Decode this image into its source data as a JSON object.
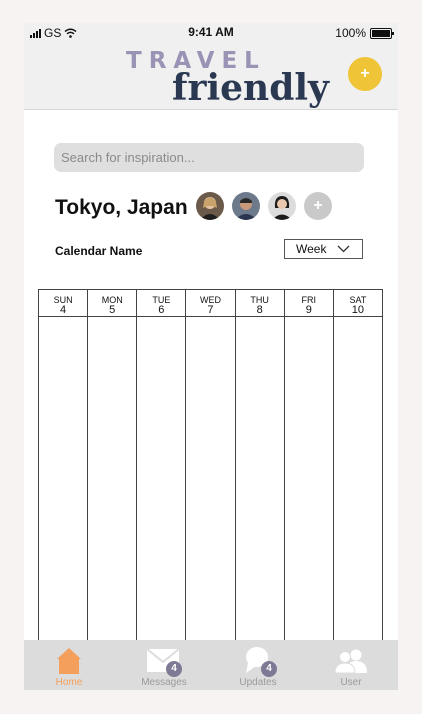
{
  "status": {
    "carrier": "GS",
    "time": "9:41 AM",
    "battery": "100%"
  },
  "header": {
    "logo_top": "TRAVEL",
    "logo_bottom": "friendly",
    "add_label": "+"
  },
  "search": {
    "placeholder": "Search for inspiration..."
  },
  "trip": {
    "city": "Tokyo, Japan",
    "add_member_label": "+"
  },
  "calendar": {
    "name_label": "Calendar Name",
    "view": "Week",
    "days": [
      {
        "name": "SUN",
        "date": "4"
      },
      {
        "name": "MON",
        "date": "5"
      },
      {
        "name": "TUE",
        "date": "6"
      },
      {
        "name": "WED",
        "date": "7"
      },
      {
        "name": "THU",
        "date": "8"
      },
      {
        "name": "FRI",
        "date": "9"
      },
      {
        "name": "SAT",
        "date": "10"
      }
    ]
  },
  "tabbar": {
    "home": "Home",
    "messages": "Messages",
    "messages_badge": "4",
    "updates": "Updates",
    "updates_badge": "4",
    "user": "User"
  },
  "colors": {
    "accent": "#efc537",
    "active_tab": "#f4a05c",
    "logo_light": "#9a93b5",
    "logo_dark": "#2a3852"
  }
}
